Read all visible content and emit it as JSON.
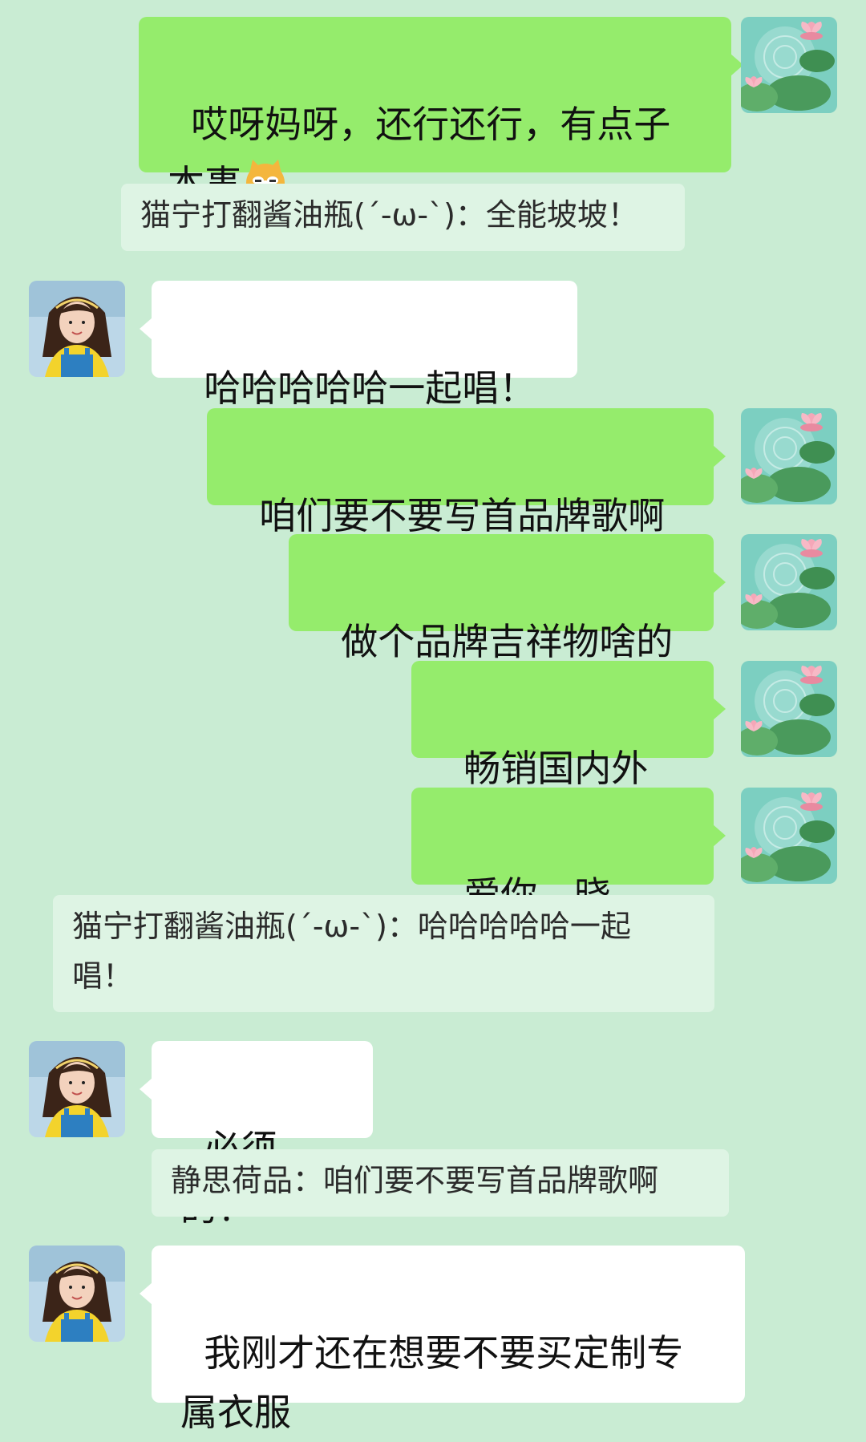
{
  "messages": [
    {
      "text1": "哎呀妈呀，还行还行，有点子",
      "text2": "本事",
      "emoji": "cat-face-emoji"
    },
    {
      "quote": "猫宁打翻酱油瓶(´-ω-`)：全能坡坡！"
    },
    {
      "text": "哈哈哈哈哈一起唱！"
    },
    {
      "text": "咱们要不要写首品牌歌啊"
    },
    {
      "text": "做个品牌吉祥物啥的"
    },
    {
      "text": "畅销国内外啊"
    },
    {
      "text": "爱你，晓然！"
    },
    {
      "quote": "猫宁打翻酱油瓶(´-ω-`)：哈哈哈哈哈一起\n唱！"
    },
    {
      "text": "必须的！"
    },
    {
      "quote": "静思荷品：咱们要不要写首品牌歌啊"
    },
    {
      "text": "我刚才还在想要不要买定制专\n属衣服"
    }
  ],
  "colors": {
    "background": "#c9ecd3",
    "mine_bubble": "#95ec6c",
    "their_bubble": "#ffffff",
    "quote_bg": "#def4e4"
  }
}
